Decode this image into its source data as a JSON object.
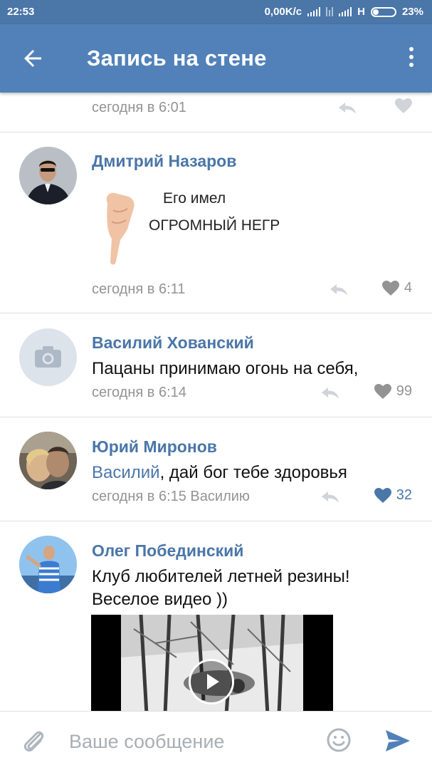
{
  "status_bar": {
    "time": "22:53",
    "net_speed": "0,00K/с",
    "network_type": "H",
    "battery": "23%"
  },
  "toolbar": {
    "title": "Запись на стене",
    "back_icon": "arrow-left-icon",
    "menu_icon": "more-vertical-icon"
  },
  "comments": [
    {
      "author": "",
      "text_partial": "...",
      "time": "сегодня в 6:01",
      "likes": ""
    },
    {
      "author": "Дмитрий Назаров",
      "sticker_lines": [
        "Его имел",
        "ОГРОМНЫЙ НЕГР"
      ],
      "time": "сегодня в 6:11",
      "likes": "4"
    },
    {
      "author": "Василий Хованский",
      "text": "Пацаны принимаю огонь на себя,",
      "time": "сегодня в 6:14",
      "likes": "99"
    },
    {
      "author": "Юрий Миронов",
      "mention": "Василий",
      "text": ", дай бог тебе здоровья",
      "time": "сегодня в 6:15 Василию",
      "likes": "32",
      "liked": true
    },
    {
      "author": "Олег Побединский",
      "text_line1": "Клуб любителей летней резины!",
      "text_line2": "Веселое видео ))"
    }
  ],
  "input": {
    "placeholder": "Ваше сообщение",
    "attach_icon": "paperclip-icon",
    "emoji_icon": "smile-icon",
    "send_icon": "send-icon"
  },
  "colors": {
    "toolbar": "#5181b8",
    "status_bar": "#4a76a8",
    "link": "#4a76a8",
    "meta": "#939393",
    "liked": "#4a76a8"
  }
}
